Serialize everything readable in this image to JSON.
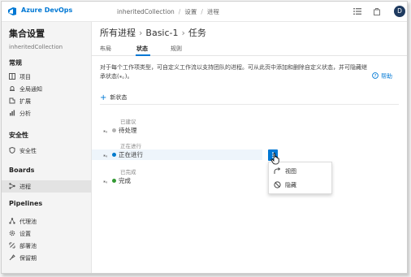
{
  "topbar": {
    "brand": "Azure DevOps",
    "breadcrumb": [
      "inheritedCollection",
      "设置",
      "进程"
    ],
    "user_initial": "D"
  },
  "sidebar": {
    "org_title": "集合设置",
    "org_subtitle": "inheritedCollection",
    "sections": [
      {
        "title": "常规",
        "items": [
          {
            "label": "项目",
            "icon": "projects-icon"
          },
          {
            "label": "全局通知",
            "icon": "notification-icon"
          },
          {
            "label": "扩展",
            "icon": "extensions-icon"
          },
          {
            "label": "分析",
            "icon": "analytics-icon"
          }
        ]
      },
      {
        "title": "安全性",
        "items": [
          {
            "label": "安全性",
            "icon": "shield-icon"
          }
        ]
      },
      {
        "title": "Boards",
        "items": [
          {
            "label": "进程",
            "icon": "process-icon",
            "selected": true
          }
        ]
      },
      {
        "title": "Pipelines",
        "items": [
          {
            "label": "代理池",
            "icon": "agent-pools-icon"
          },
          {
            "label": "设置",
            "icon": "gear-icon"
          },
          {
            "label": "部署池",
            "icon": "deployment-pools-icon"
          },
          {
            "label": "保留期",
            "icon": "retention-icon"
          }
        ]
      }
    ]
  },
  "page": {
    "breadcrumb": [
      "所有进程",
      "Basic-1",
      "任务"
    ],
    "tabs": [
      "布局",
      "状态",
      "规则"
    ],
    "active_tab": "状态",
    "description": "对于每个工作项类型，可自定义工作流以支持团队的进程。可从此页中添加和删除自定义状态，并可隐藏继承状态(⁎。)。",
    "help_label": "帮助",
    "new_state_label": "新状态",
    "categories": [
      {
        "label": "已建议",
        "states": [
          {
            "name": "待处理",
            "color": "#b2b2b2",
            "inherited_marker": "⁎。"
          }
        ]
      },
      {
        "label": "正在进行",
        "states": [
          {
            "name": "正在进行",
            "color": "#007acc",
            "inherited_marker": "⁎。"
          }
        ]
      },
      {
        "label": "已完成",
        "states": [
          {
            "name": "完成",
            "color": "#339933",
            "inherited_marker": "⁎。"
          }
        ]
      }
    ],
    "context_menu": {
      "items": [
        {
          "label": "视图",
          "icon": "view-icon"
        },
        {
          "label": "隐藏",
          "icon": "hide-icon"
        }
      ]
    }
  },
  "colors": {
    "accent": "#0078d4",
    "sidebar_bg": "#f4f4f4",
    "highlight_row": "#eef5fb"
  }
}
